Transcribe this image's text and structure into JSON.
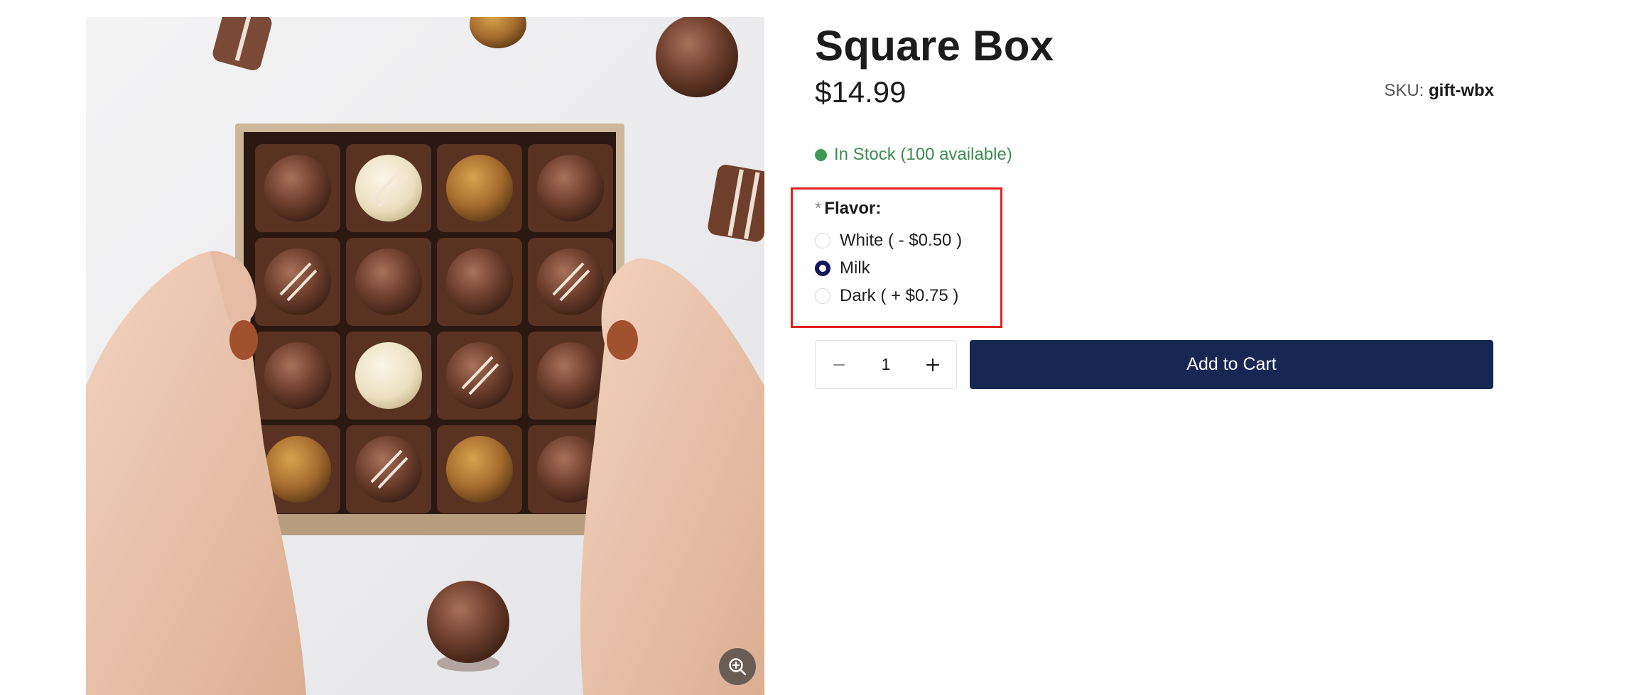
{
  "product": {
    "title": "Square Box",
    "price": "$14.99",
    "sku_label": "SKU:",
    "sku_value": "gift-wbx",
    "stock_text": "In Stock (100 available)",
    "image_alt": "Square box of assorted chocolates"
  },
  "flavor": {
    "required_mark": "*",
    "label": "Flavor:",
    "options": [
      {
        "label": "White ( - $0.50 )",
        "selected": false
      },
      {
        "label": "Milk",
        "selected": true
      },
      {
        "label": "Dark ( + $0.75 )",
        "selected": false
      }
    ]
  },
  "quantity": {
    "value": "1",
    "decrement_icon": "minus-icon",
    "increment_icon": "plus-icon"
  },
  "cart": {
    "button_label": "Add to Cart"
  },
  "icons": {
    "zoom": "zoom-in-icon"
  },
  "colors": {
    "primary_button": "#172753",
    "stock_green": "#3e8c4e",
    "highlight_border": "#e41f1f",
    "radio_checked": "#13175c"
  }
}
